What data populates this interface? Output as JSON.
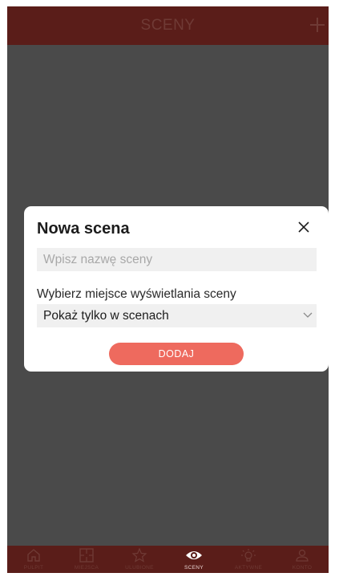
{
  "header": {
    "title": "SCENY",
    "add_icon": "plus-icon"
  },
  "modal": {
    "title": "Nowa scena",
    "close_icon": "close-icon",
    "name_input": {
      "value": "",
      "placeholder": "Wpisz nazwę sceny"
    },
    "location_label": "Wybierz miejsce wyświetlania sceny",
    "location_select": {
      "selected": "Pokaż tylko w scenach",
      "icon": "chevron-down-icon"
    },
    "submit_label": "DODAJ"
  },
  "tabbar": {
    "items": [
      {
        "label": "PULPIT",
        "icon": "home-icon",
        "active": false
      },
      {
        "label": "MIEJSCA",
        "icon": "floorplan-icon",
        "active": false
      },
      {
        "label": "ULUBIONE",
        "icon": "star-icon",
        "active": false
      },
      {
        "label": "SCENY",
        "icon": "eye-icon",
        "active": true
      },
      {
        "label": "AKTYWNE",
        "icon": "lightbulb-icon",
        "active": false
      },
      {
        "label": "KONTO",
        "icon": "user-icon",
        "active": false
      }
    ]
  },
  "colors": {
    "header_bg": "#5a1d19",
    "overlay_bg": "#4a4a4a",
    "accent": "#ee6a5e",
    "inactive_text": "#6f3a35",
    "active_text": "#e9d4d2"
  }
}
